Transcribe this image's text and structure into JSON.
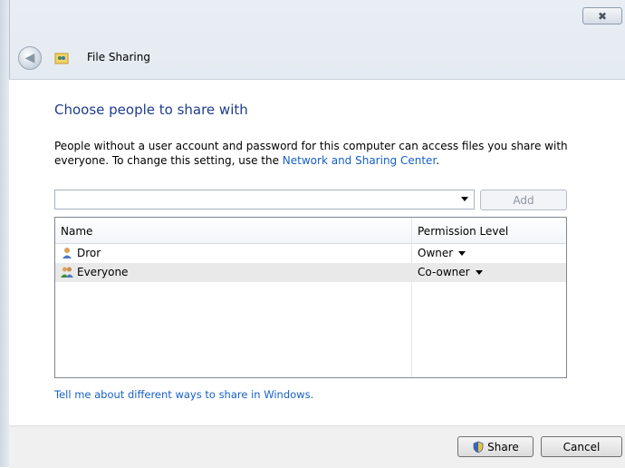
{
  "window": {
    "title": "File Sharing",
    "close_glyph": "✖"
  },
  "main": {
    "heading": "Choose people to share with",
    "description_text": "People without a user account and password for this computer can access files you share with everyone. To change this setting, use the ",
    "description_link": "Network and Sharing Center",
    "description_end": ".",
    "people_input_value": "",
    "add_label": "Add",
    "list": {
      "columns": [
        "Name",
        "Permission Level"
      ],
      "rows": [
        {
          "name": "Dror",
          "permission": "Owner",
          "icon": "user-icon"
        },
        {
          "name": "Everyone",
          "permission": "Co-owner",
          "icon": "group-icon"
        }
      ]
    },
    "help_link": "Tell me about different ways to share in Windows."
  },
  "footer": {
    "share_label": "Share",
    "cancel_label": "Cancel"
  },
  "colors": {
    "heading": "#1e3d8f",
    "link": "#1660c6"
  }
}
